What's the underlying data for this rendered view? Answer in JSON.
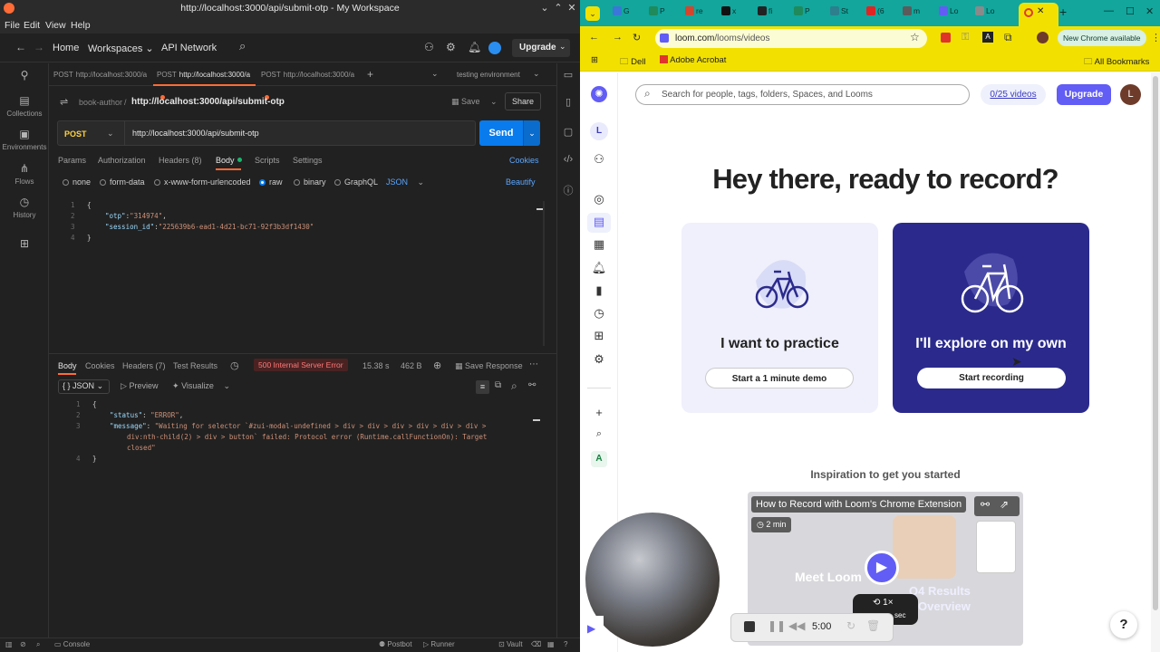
{
  "postman": {
    "window_title": "http://localhost:3000/api/submit-otp - My Workspace",
    "menu": [
      "File",
      "Edit",
      "View",
      "Help"
    ],
    "header": {
      "home": "Home",
      "workspaces": "Workspaces",
      "api_network": "API Network",
      "upgrade": "Upgrade"
    },
    "sidebar": [
      {
        "label": "",
        "icon": "user-icon"
      },
      {
        "label": "Collections",
        "icon": "collections-icon"
      },
      {
        "label": "Environments",
        "icon": "environments-icon"
      },
      {
        "label": "Flows",
        "icon": "flows-icon"
      },
      {
        "label": "History",
        "icon": "history-icon"
      },
      {
        "label": "",
        "icon": "apps-icon"
      }
    ],
    "tabs": [
      {
        "method": "POST",
        "label": "http://localhost:3000/a"
      },
      {
        "method": "POST",
        "label": "http://localhost:3000/a"
      },
      {
        "method": "POST",
        "label": "http://localhost:3000/a"
      }
    ],
    "environment": "testing environment",
    "breadcrumb": {
      "collection": "book-author",
      "sep": "/",
      "name": "http://localhost:3000/api/submit-otp"
    },
    "save": "Save",
    "share": "Share",
    "request": {
      "method": "POST",
      "url": "http://localhost:3000/api/submit-otp",
      "send": "Send"
    },
    "req_tabs": {
      "params": "Params",
      "authorization": "Authorization",
      "headers": "Headers (8)",
      "body": "Body",
      "scripts": "Scripts",
      "settings": "Settings",
      "cookies": "Cookies"
    },
    "body_types": {
      "none": "none",
      "form_data": "form-data",
      "urlencoded": "x-www-form-urlencoded",
      "raw": "raw",
      "binary": "binary",
      "graphql": "GraphQL",
      "json": "JSON",
      "beautify": "Beautify"
    },
    "req_body": {
      "l1": "1",
      "l2": "2",
      "l3": "3",
      "l4": "4",
      "open": "{",
      "close": "}",
      "k1": "\"otp\"",
      "v1": "\"314974\"",
      "k2": "\"session_id\"",
      "v2": "\"225639b6-ead1-4d21-bc71-92f3b3df1430\""
    },
    "resp_tabs": {
      "body": "Body",
      "cookies": "Cookies",
      "headers": "Headers (7)",
      "tests": "Test Results"
    },
    "resp_status": "500 Internal Server Error",
    "resp_time": "15.38 s",
    "resp_size": "462 B",
    "save_response": "Save Response",
    "resp_view": {
      "format": "JSON",
      "preview": "Preview",
      "visualize": "Visualize"
    },
    "resp_body": {
      "l1": "1",
      "l2": "2",
      "l3": "3",
      "l4": "4",
      "open": "{",
      "close": "}",
      "k1": "\"status\"",
      "v1": "\"ERROR\"",
      "k2": "\"message\"",
      "v2a": "\"Waiting for selector `#zui-modal-undefined > div > div > div > div > div > div >",
      "v2b": "div:nth-child(2) > div > button` failed: Protocol error (Runtime.callFunctionOn): Target",
      "v2c": "closed\""
    },
    "statusbar": {
      "console": "Console",
      "postbot": "Postbot",
      "runner": "Runner",
      "vault": "Vault"
    }
  },
  "chrome": {
    "tabs": [
      {
        "label": "G",
        "color": "#3a77d8"
      },
      {
        "label": "P",
        "color": "#1f8a5b"
      },
      {
        "label": "re",
        "color": "#d4452e"
      },
      {
        "label": "x",
        "color": "#111111"
      },
      {
        "label": "fi",
        "color": "#222222"
      },
      {
        "label": "P",
        "color": "#1f8a5b"
      },
      {
        "label": "St",
        "color": "#2d7f8e"
      },
      {
        "label": "(6",
        "color": "#e02424"
      },
      {
        "label": "m",
        "color": "#5b5b5b"
      },
      {
        "label": "Lo",
        "color": "#625df5"
      },
      {
        "label": "Lo",
        "color": "#8a8a8a"
      }
    ],
    "url_host": "loom.com",
    "url_path": "/looms/videos",
    "new_chrome": "New Chrome available",
    "bookmarks": {
      "dell": "Dell",
      "acrobat": "Adobe Acrobat",
      "all": "All Bookmarks"
    },
    "accent": "#f2e100",
    "tabstrip_color": "#12a69c"
  },
  "loom": {
    "search_placeholder": "Search for people, tags, folders, Spaces, and Looms",
    "video_count": "0/25 videos",
    "upgrade": "Upgrade",
    "avatar": "L",
    "workspace_letter": "L",
    "hero": "Hey there, ready to record?",
    "practice": {
      "title": "I want to practice",
      "button": "Start a 1 minute demo"
    },
    "explore": {
      "title": "I'll explore on my own",
      "button": "Start recording"
    },
    "inspiration": "Inspiration to get you started",
    "video": {
      "title": "How to Record with Loom's Chrome Extension",
      "duration": "2 min",
      "overlay_text": "Meet Loom",
      "overlay_text2": "Q4 Results",
      "overlay_text3": "Overview",
      "speed": "1×",
      "sec": "sec"
    },
    "recorder": {
      "time": "5:00"
    },
    "help": "?",
    "brand_color": "#625df5",
    "explore_bg": "#2b2a8c"
  }
}
